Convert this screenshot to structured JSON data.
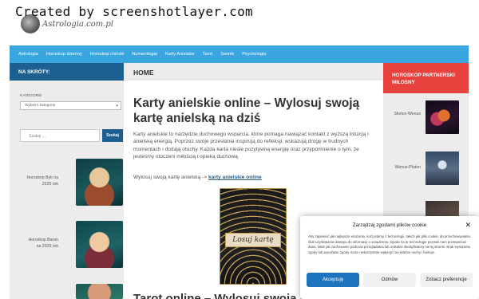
{
  "watermark": "Created by screenshotlayer.com",
  "logo": {
    "text": "Astrologia.com.pl"
  },
  "nav": {
    "items": [
      "Astrologia",
      "Horoskop dzienny",
      "Horoskop chiński",
      "Numerologia",
      "Karty Anielskie",
      "Tarot",
      "Sennik",
      "Psychologia"
    ]
  },
  "sidebar_left": {
    "header": "NA SKRÓTY:",
    "category_label": "KATEGORIE",
    "category_select": "Wybierz kategorię",
    "search_placeholder": "Szukaj …",
    "search_button": "Szukaj",
    "posts": [
      {
        "title": "Horoskop Byk na 2025 rok"
      },
      {
        "title": "Horoskop Baran na 2025 rok"
      }
    ]
  },
  "main": {
    "breadcrumb": "HOME",
    "title": "Karty anielskie online – Wylosuj swoją kartę anielską na dziś",
    "body": "Karty anielskie to narzędzie duchowego wsparcia, które pomaga nawiązać kontakt z wyższą intuicją i anielską energią. Poprzez swoje przesłania inspirują do refleksji, wskazują drogę w trudnych momentach i dodają otuchy. Każda karta niesie pozytywną energię oraz przypomnienie o tym, że jesteśmy otoczeni miłością i opieką duchową.",
    "link_prefix": "Wylosuj swoją kartę anielską ->",
    "link_text": "karty anielskie online",
    "card_label": "Losuj kartę",
    "second_title": "Tarot online – Wylosuj swoją kartę tarota"
  },
  "sidebar_right": {
    "header": "HOROSKOP PARTNERSKI MIŁOSNY",
    "posts": [
      {
        "title": "Słońce-Wenus"
      },
      {
        "title": "Wenus-Pluton"
      }
    ]
  },
  "consent": {
    "title": "Zarządzaj zgodami plików cookie",
    "text": "Aby zapewnić jak najlepsze wrażenia, korzystamy z technologii, takich jak pliki cookie, do przechowywania i/lub uzyskiwania dostępu do informacji o urządzeniu. Zgoda na te technologie pozwoli nam przetwarzać dane, takie jak zachowanie podczas przeglądania lub unikalne identyfikatory na tej stronie. Brak wyrażenia zgody lub wycofanie zgody może niekorzystnie wpłynąć na niektóre cechy i funkcje.",
    "accept": "Akceptuję",
    "deny": "Odmów",
    "preferences": "Zobacz preferencje"
  }
}
